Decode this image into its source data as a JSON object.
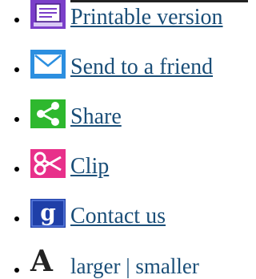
{
  "tools": {
    "items": [
      {
        "label": "Printable version",
        "icon": "print-icon",
        "icon_color": "#7b3fc9"
      },
      {
        "label": "Send to a friend",
        "icon": "envelope-icon",
        "icon_color": "#2c8fe0"
      },
      {
        "label": "Share",
        "icon": "share-icon",
        "icon_color": "#2eb82e"
      },
      {
        "label": "Clip",
        "icon": "scissors-icon",
        "icon_color": "#e8308a"
      },
      {
        "label": "Contact us",
        "icon": "contact-icon",
        "icon_color": "#1f3fa8"
      }
    ],
    "text_size": {
      "icon_letter": "A",
      "larger": "larger",
      "separator": " | ",
      "smaller": "smaller"
    }
  },
  "colors": {
    "link": "#1a4e78",
    "text": "#222222"
  }
}
